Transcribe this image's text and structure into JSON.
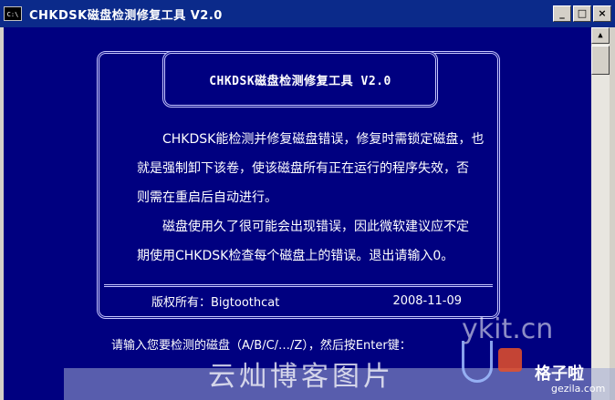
{
  "window": {
    "title": "CHKDSK磁盘检测修复工具 V2.0",
    "icon_label": "C:\\",
    "buttons": {
      "minimize": "_",
      "maximize": "□",
      "close": "×"
    }
  },
  "scrollbar": {
    "up_arrow": "▲"
  },
  "console": {
    "box_title": "CHKDSK磁盘检测修复工具 V2.0",
    "paragraph1": [
      "　　CHKDSK能检测并修复磁盘错误，修复时需锁定磁盘，也",
      "就是强制卸下该卷，使该磁盘所有正在运行的程序失效，否",
      "则需在重启后自动进行。"
    ],
    "paragraph2": [
      "　　磁盘使用久了很可能会出现错误，因此微软建议应不定",
      "期使用CHKDSK检查每个磁盘上的错误。退出请输入0。"
    ],
    "copyright": "版权所有：Bigtoothcat",
    "date": "2008-11-09",
    "prompt": "请输入您要检测的磁盘（A/B/C/…/Z），然后按Enter键："
  },
  "watermarks": {
    "site1": "ykit.cn",
    "site1_caption": "云灿博客图片",
    "site2": "格子啦",
    "site2_domain": "gezila.com"
  },
  "colors": {
    "console_bg": "#000080",
    "titlebar_bg": "#0b2a8a",
    "frame_line": "#c8c8ff",
    "text": "#ffffff"
  }
}
